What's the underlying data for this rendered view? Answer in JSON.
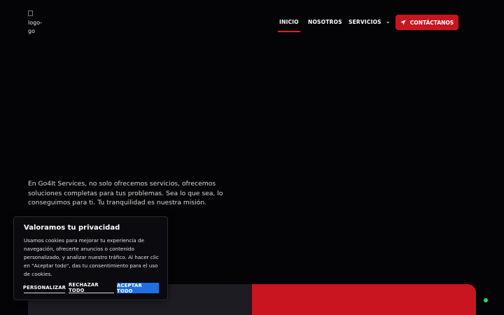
{
  "header": {
    "logo_alt": "logo-go",
    "nav": [
      {
        "label": "INICIO",
        "active": true
      },
      {
        "label": "NOSOTROS",
        "active": false
      },
      {
        "label": "SERVICIOS",
        "active": false
      }
    ],
    "cta_label": "CONTÁCTANOS",
    "cta_icon": "send-icon"
  },
  "hero": {
    "text": "En Go4It Services, no solo ofrecemos servicios, ofrecemos soluciones completas para tus problemas. Sea lo que sea, lo conseguimos para ti. Tu tranquilidad es nuestra misión."
  },
  "cookie_banner": {
    "title": "Valoramos tu privacidad",
    "body": "Usamos cookies para mejorar tu experiencia de navegación, ofrecerte anuncios o contenido personalizado, y analizar nuestro tráfico. Al hacer clic en \"Aceptar todo\", das tu consentimiento para el uso de cookies.",
    "buttons": {
      "customize": "PERSONALIZAR",
      "reject": "RECHAZAR TODO",
      "accept": "ACEPTAR TODO"
    }
  },
  "colors": {
    "background": "#040406",
    "accent_red": "#c8151f",
    "accept_blue": "#1f6fe0",
    "status_green": "#2fd36b"
  }
}
